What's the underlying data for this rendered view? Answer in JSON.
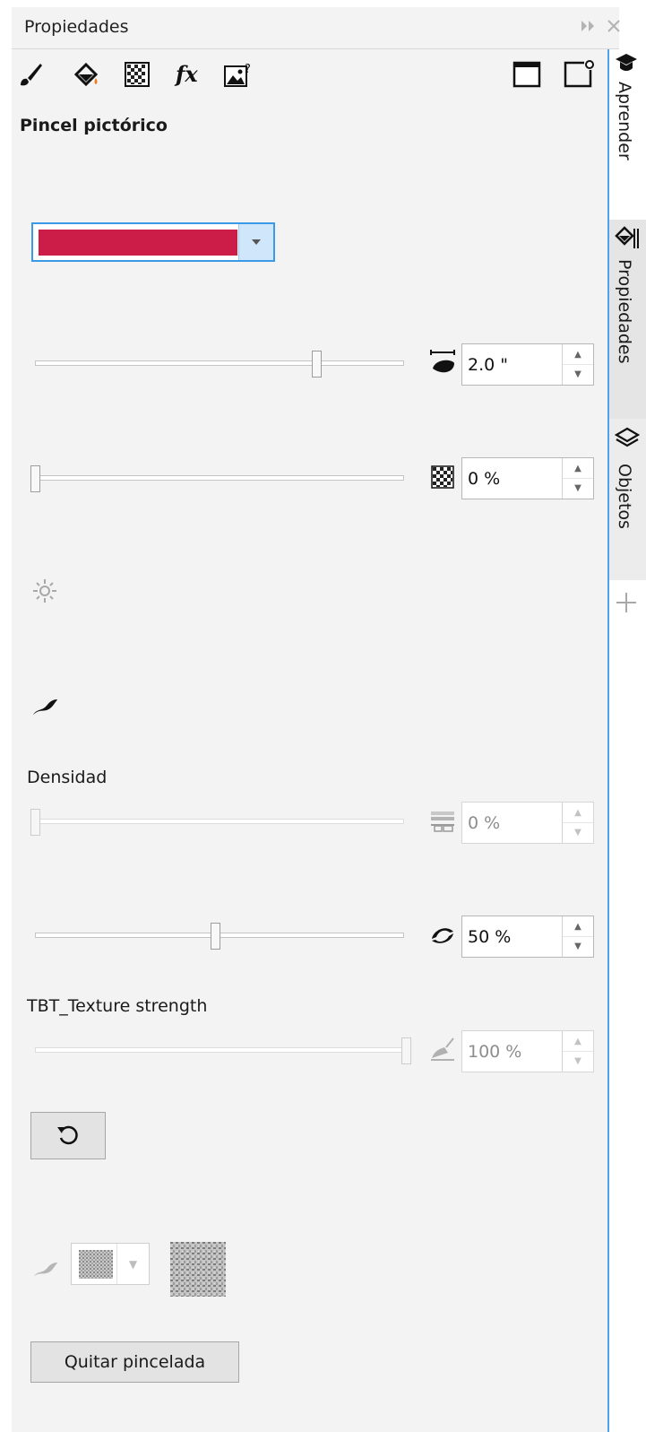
{
  "panel": {
    "title": "Propiedades",
    "header_buttons": [
      "expand-icon",
      "close-icon"
    ]
  },
  "toolbar": {
    "tabs": [
      "brush-icon",
      "fill-icon",
      "transparency-icon",
      "fx-icon",
      "image-adjust-icon"
    ],
    "right_buttons": [
      "frame-icon",
      "frame-options-icon"
    ]
  },
  "section": {
    "title": "Pincel pictórico"
  },
  "color": {
    "value": "#cc1c48"
  },
  "size": {
    "value": "2.0 \"",
    "slider_level": 0.77
  },
  "transparency": {
    "value": "0 %",
    "slider_level": 0.0
  },
  "icons": {
    "light": "sun-icon",
    "stroke": "stroke-icon"
  },
  "density": {
    "label": "Densidad",
    "value": "0 %",
    "slider_level": 0.0,
    "enabled": false
  },
  "rotation": {
    "value": "50 %",
    "slider_level": 0.49
  },
  "texture_strength": {
    "label": "TBT_Texture strength",
    "value": "100 %",
    "slider_level": 1.0,
    "enabled": false
  },
  "reset_button": {
    "icon": "reset-icon"
  },
  "remove_button": {
    "label": "Quitar pincelada"
  },
  "side_tabs": [
    {
      "label": "Aprender",
      "icon": "cap-icon",
      "active": false
    },
    {
      "label": "Propiedades",
      "icon": "properties-icon",
      "active": true
    },
    {
      "label": "Objetos",
      "icon": "layers-icon",
      "active": false
    }
  ],
  "side_add": "plus-icon",
  "colors": {
    "accent": "#3a9ae8",
    "brush_color": "#cc1c48"
  }
}
